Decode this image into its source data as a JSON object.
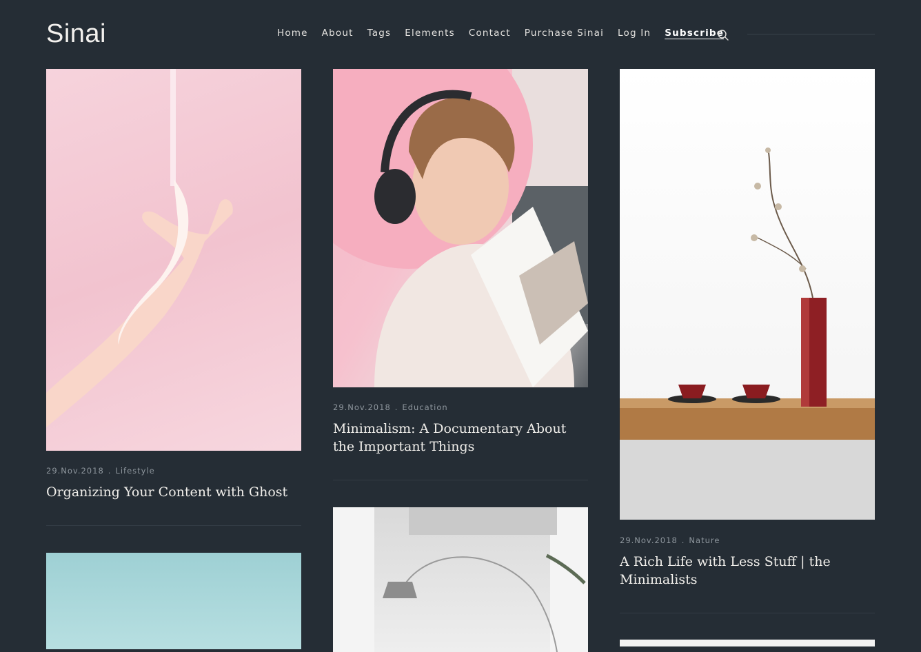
{
  "brand": {
    "logo": "Sinai"
  },
  "nav": {
    "items": [
      "Home",
      "About",
      "Tags",
      "Elements",
      "Contact",
      "Purchase Sinai",
      "Log In"
    ],
    "subscribe": "Subscribe"
  },
  "posts": [
    {
      "date": "29.Nov.2018",
      "tag": "Lifestyle",
      "title": "Organizing Your Content with Ghost"
    },
    {
      "date": "29.Nov.2018",
      "tag": "Education",
      "title": "Minimalism: A Documentary About the Important Things"
    },
    {
      "date": "29.Nov.2018",
      "tag": "Nature",
      "title": "A Rich Life with Less Stuff | the Minimalists"
    }
  ],
  "colors": {
    "background": "#252d35",
    "text": "#f0eeea",
    "meta": "#8e969d"
  }
}
